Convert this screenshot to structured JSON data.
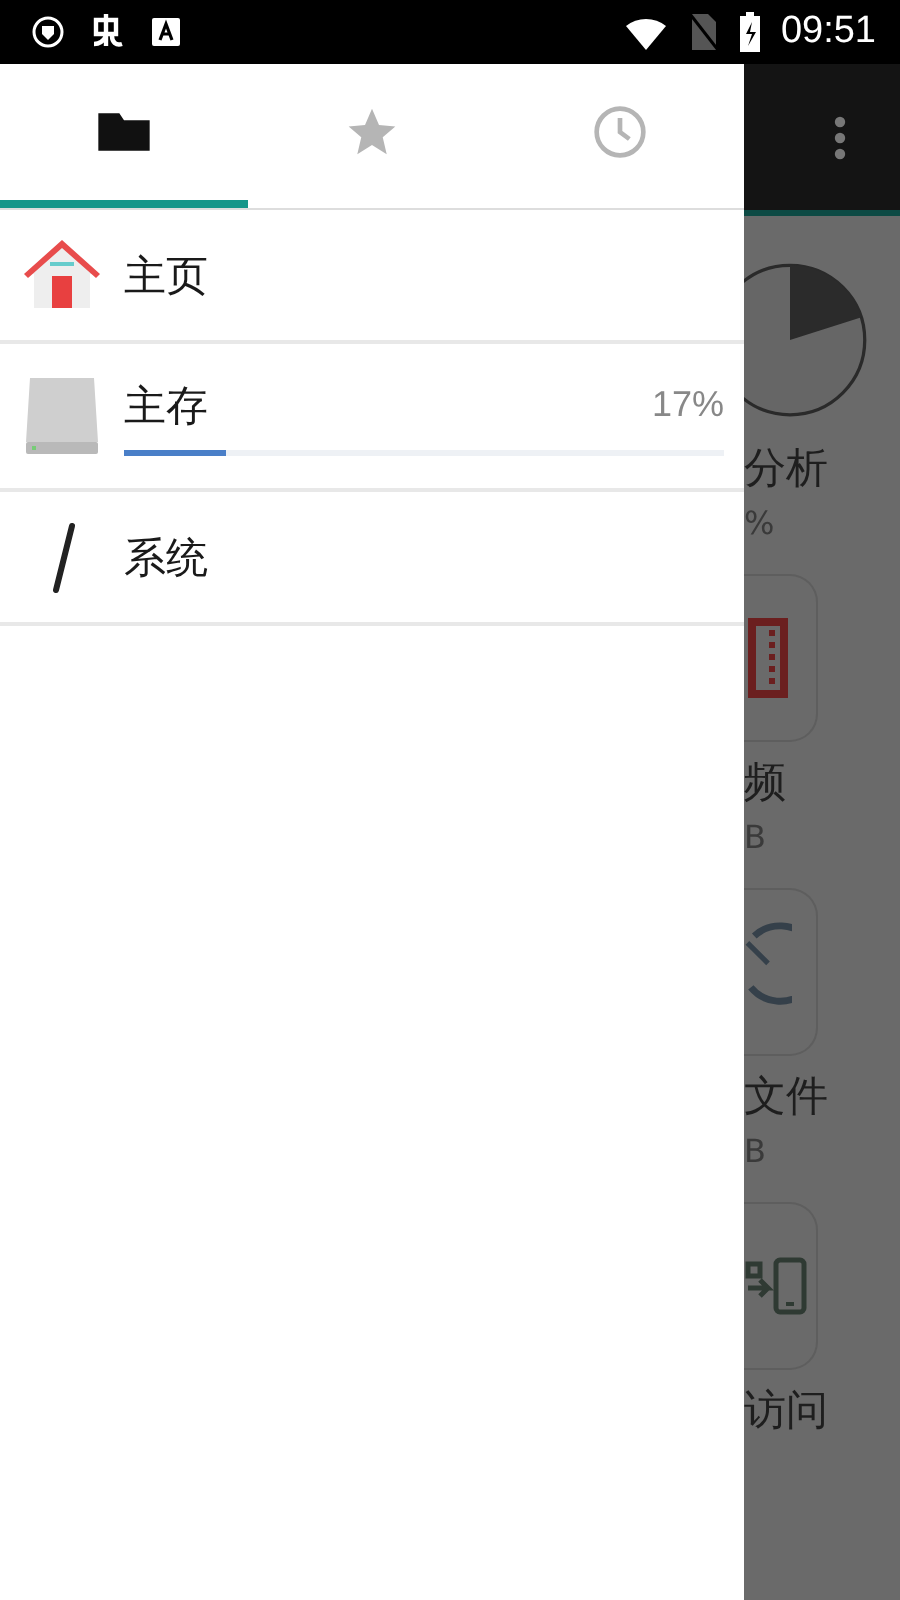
{
  "status_bar": {
    "time": "09:51"
  },
  "drawer": {
    "tabs": [
      {
        "kind": "folder",
        "selected": true
      },
      {
        "kind": "star",
        "selected": false
      },
      {
        "kind": "clock",
        "selected": false
      }
    ],
    "items": [
      {
        "kind": "home",
        "label": "主页"
      },
      {
        "kind": "storage",
        "label": "主存",
        "reading": "17%",
        "level": 0.17
      },
      {
        "kind": "root",
        "label": "系统"
      }
    ]
  },
  "background_items": [
    {
      "kind": "chart",
      "title": "分析",
      "caption": "%"
    },
    {
      "kind": "video",
      "title": "频",
      "caption": "B"
    },
    {
      "kind": "recent",
      "title": "文件",
      "caption": "B"
    },
    {
      "kind": "network",
      "title": "访问"
    }
  ]
}
